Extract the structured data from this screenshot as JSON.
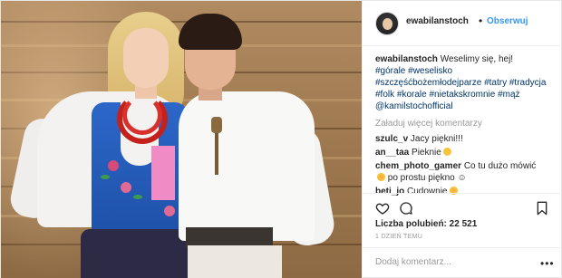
{
  "header": {
    "username": "ewabilanstoch",
    "separator": "•",
    "follow_label": "Obserwuj"
  },
  "caption": {
    "username": "ewabilanstoch",
    "text": "Weselimy się, hej!",
    "hashtags": [
      "#górale",
      "#weselisko",
      "#szczęśćbożemłodejparze",
      "#tatry",
      "#tradycja",
      "#folk",
      "#korale",
      "#nietakskromnie",
      "#mąż",
      "@kamilstochofficial"
    ]
  },
  "load_more_label": "Załaduj więcej komentarzy",
  "comments": [
    {
      "username": "szulc_v",
      "text": "Jacy piękni!!!"
    },
    {
      "username": "an__taa",
      "text": "Pieknie"
    },
    {
      "username": "chem_photo_gamer",
      "text": "Co tu dużo mówić",
      "text2": "po prostu piękno ☺"
    },
    {
      "username": "beti_jo",
      "text": "Cudownie"
    }
  ],
  "actions": {
    "like_icon": "heart-icon",
    "comment_icon": "comment-icon",
    "save_icon": "bookmark-icon"
  },
  "likes": {
    "label": "Liczba polubień:",
    "count": "22 521"
  },
  "timestamp": "1 DZIEŃ TEMU",
  "add_comment": {
    "placeholder": "Dodaj komentarz...",
    "more_label": "•••"
  },
  "colors": {
    "link": "#3897f0",
    "hashtag": "#003569",
    "muted": "#999999",
    "emoji": "#f7c23c"
  }
}
